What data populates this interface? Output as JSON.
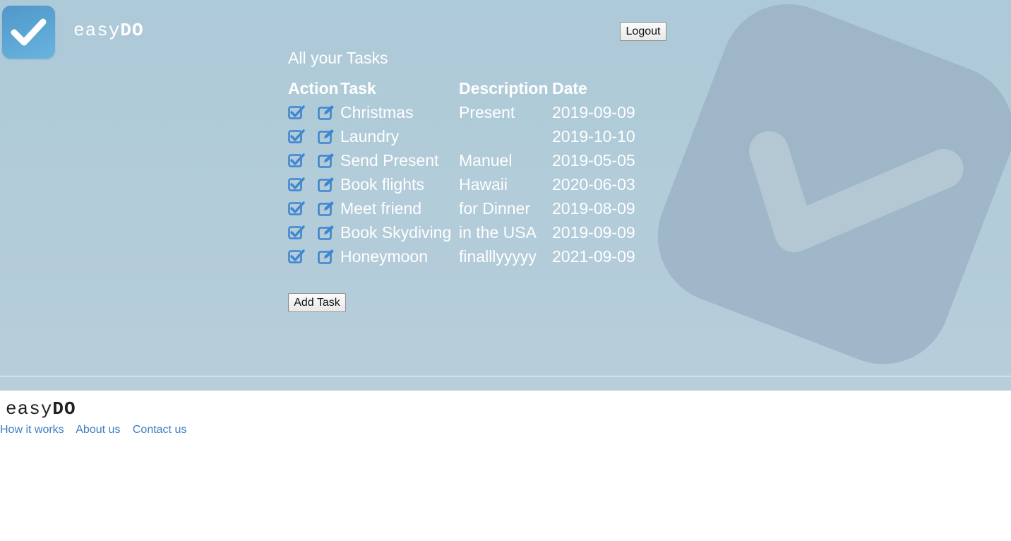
{
  "header": {
    "logo_icon": "checkmark-icon",
    "brand_light": "easy",
    "brand_bold": "DO",
    "logout_label": "Logout"
  },
  "main": {
    "title": "All your Tasks",
    "columns": [
      "Action",
      "Task",
      "Description",
      "Date"
    ],
    "tasks": [
      {
        "task": "Christmas",
        "description": "Present",
        "date": "2019-09-09"
      },
      {
        "task": "Laundry",
        "description": "",
        "date": "2019-10-10"
      },
      {
        "task": "Send Present",
        "description": "Manuel",
        "date": "2019-05-05"
      },
      {
        "task": "Book flights",
        "description": "Hawaii",
        "date": "2020-06-03"
      },
      {
        "task": "Meet friend",
        "description": "for Dinner",
        "date": "2019-08-09"
      },
      {
        "task": "Book Skydiving",
        "description": "in the USA",
        "date": "2019-09-09"
      },
      {
        "task": "Honeymoon",
        "description": "finalllyyyyy",
        "date": "2021-09-09"
      }
    ],
    "action_icons": [
      "check-square-icon",
      "edit-icon"
    ],
    "add_task_label": "Add Task"
  },
  "footer": {
    "brand_light": "easy",
    "brand_bold": "DO",
    "links": [
      "How it works",
      "About us",
      "Contact us"
    ]
  },
  "colors": {
    "hero_background": "#b0cbd9",
    "icon_blue": "#3f86cf",
    "link_blue": "#3d7dc2",
    "text_white": "#ffffff"
  }
}
